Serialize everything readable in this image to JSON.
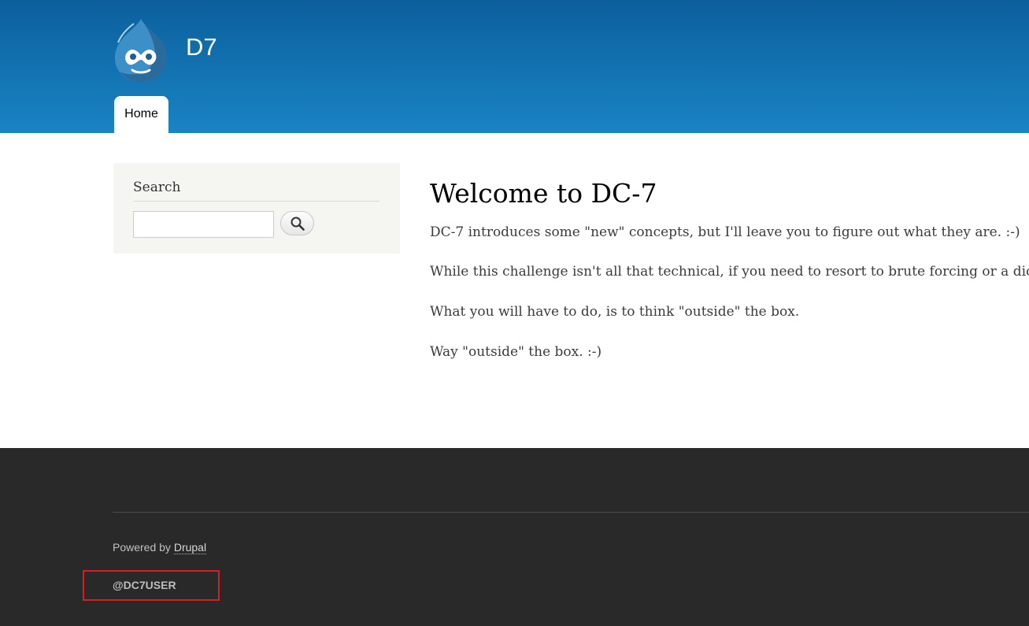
{
  "header": {
    "site_name": "D7",
    "logo_icon": "drupal-drop-icon",
    "menu": [
      {
        "label": "Home",
        "active": true
      }
    ]
  },
  "sidebar": {
    "search_block": {
      "title": "Search",
      "input_value": "",
      "button_icon": "search-icon"
    }
  },
  "main": {
    "title": "Welcome to DC-7",
    "paragraphs": [
      "DC-7 introduces some \"new\" concepts, but I'll leave you to figure out what they are.  :-)",
      "While this challenge isn't all that technical, if you need to resort to brute forcing or a dictiona",
      "What you will have to do, is to think \"outside\" the box.",
      "Way \"outside\" the box.  :-)"
    ]
  },
  "footer": {
    "powered_prefix": "Powered by ",
    "powered_link": "Drupal",
    "twitter_handle": "@DC7USER"
  },
  "colors": {
    "header_top": "#0b5f9c",
    "header_bottom": "#1a84c4",
    "sidebar_bg": "#f5f5f1",
    "footer_bg": "#292929",
    "highlight_box": "#d5201f"
  }
}
